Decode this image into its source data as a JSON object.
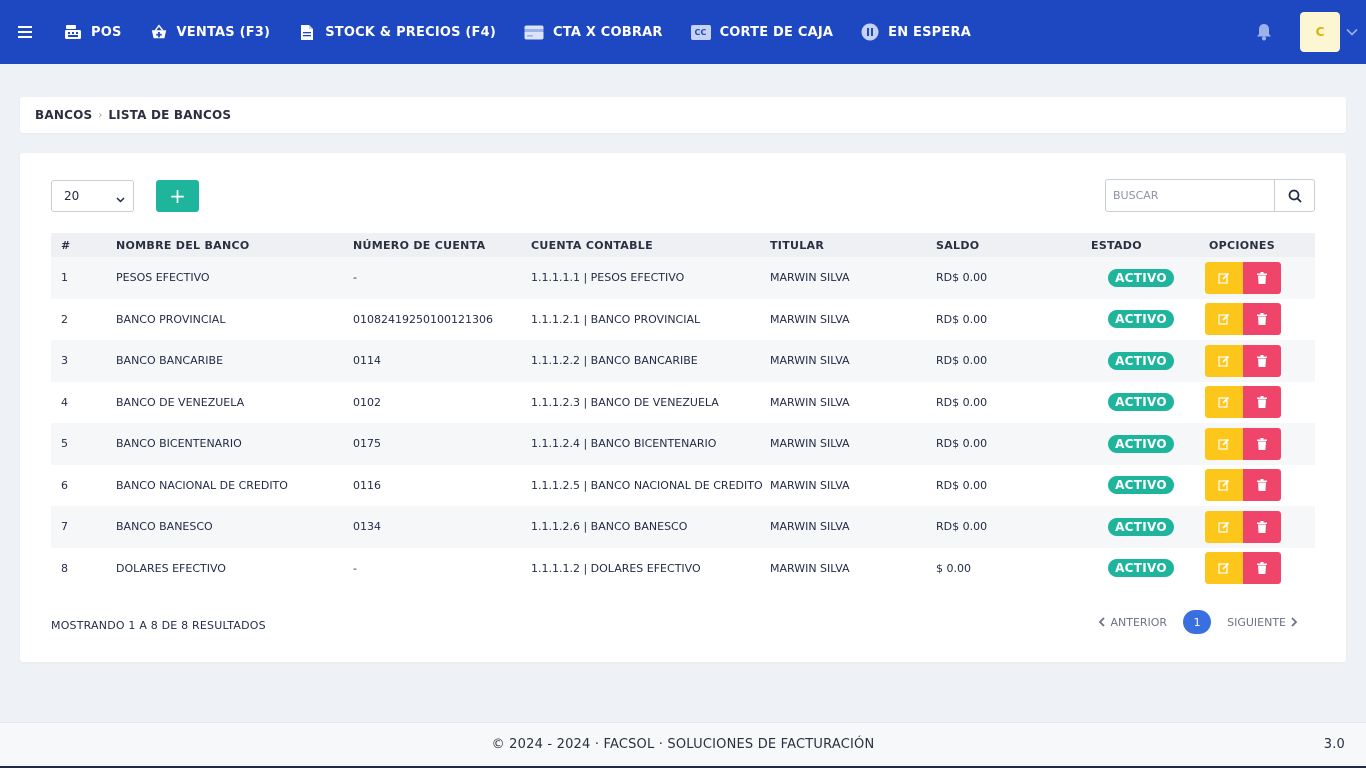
{
  "navbar": {
    "items": [
      {
        "label": "POS",
        "icon": "cash-register-icon"
      },
      {
        "label": "VENTAS (F3)",
        "icon": "basket-plus-icon"
      },
      {
        "label": "STOCK & PRECIOS (F4)",
        "icon": "document-icon"
      },
      {
        "label": "CTA X COBRAR",
        "icon": "credit-card-icon"
      },
      {
        "label": "CORTE DE CAJA",
        "icon": "cc-badge-icon"
      },
      {
        "label": "EN ESPERA",
        "icon": "pause-circle-icon"
      }
    ],
    "cc_badge_text": "CC",
    "avatar_initial": "C",
    "accent_color": "#1e47c2"
  },
  "breadcrumb": {
    "parent": "BANCOS",
    "current": "LISTA DE BANCOS"
  },
  "toolbar": {
    "page_size": "20",
    "add_label": "+",
    "search_placeholder": "BUSCAR"
  },
  "table": {
    "headers": [
      "#",
      "NOMBRE DEL BANCO",
      "NÚMERO DE CUENTA",
      "CUENTA CONTABLE",
      "TITULAR",
      "SALDO",
      "ESTADO",
      "OPCIONES"
    ],
    "rows": [
      {
        "num": "1",
        "nombre": "PESOS EFECTIVO",
        "cuenta": "-",
        "contable": "1.1.1.1.1 | PESOS EFECTIVO",
        "titular": "MARWIN SILVA",
        "saldo": "RD$ 0.00",
        "estado": "ACTIVO"
      },
      {
        "num": "2",
        "nombre": "BANCO PROVINCIAL",
        "cuenta": "01082419250100121306",
        "contable": "1.1.1.2.1 | BANCO PROVINCIAL",
        "titular": "MARWIN SILVA",
        "saldo": "RD$ 0.00",
        "estado": "ACTIVO"
      },
      {
        "num": "3",
        "nombre": "BANCO BANCARIBE",
        "cuenta": "0114",
        "contable": "1.1.1.2.2 | BANCO BANCARIBE",
        "titular": "MARWIN SILVA",
        "saldo": "RD$ 0.00",
        "estado": "ACTIVO"
      },
      {
        "num": "4",
        "nombre": "BANCO DE VENEZUELA",
        "cuenta": "0102",
        "contable": "1.1.1.2.3 | BANCO DE VENEZUELA",
        "titular": "MARWIN SILVA",
        "saldo": "RD$ 0.00",
        "estado": "ACTIVO"
      },
      {
        "num": "5",
        "nombre": "BANCO BICENTENARIO",
        "cuenta": "0175",
        "contable": "1.1.1.2.4 | BANCO BICENTENARIO",
        "titular": "MARWIN SILVA",
        "saldo": "RD$ 0.00",
        "estado": "ACTIVO"
      },
      {
        "num": "6",
        "nombre": "BANCO NACIONAL DE CREDITO",
        "cuenta": "0116",
        "contable": "1.1.1.2.5 | BANCO NACIONAL DE CREDITO",
        "titular": "MARWIN SILVA",
        "saldo": "RD$ 0.00",
        "estado": "ACTIVO"
      },
      {
        "num": "7",
        "nombre": "BANCO BANESCO",
        "cuenta": "0134",
        "contable": "1.1.1.2.6 | BANCO BANESCO",
        "titular": "MARWIN SILVA",
        "saldo": "RD$ 0.00",
        "estado": "ACTIVO"
      },
      {
        "num": "8",
        "nombre": "DOLARES EFECTIVO",
        "cuenta": "-",
        "contable": "1.1.1.1.2 | DOLARES EFECTIVO",
        "titular": "MARWIN SILVA",
        "saldo": "$ 0.00",
        "estado": "ACTIVO"
      }
    ],
    "status_color": "#1fb59d",
    "edit_color": "#fdc61b",
    "delete_color": "#f0456a"
  },
  "pagination": {
    "summary": "MOSTRANDO 1 A 8 DE 8 RESULTADOS",
    "prev_label": "ANTERIOR",
    "current_page": "1",
    "next_label": "SIGUIENTE"
  },
  "footer": {
    "text": "© 2024 - 2024 · FACSOL · SOLUCIONES DE FACTURACIÓN",
    "version": "3.0"
  }
}
